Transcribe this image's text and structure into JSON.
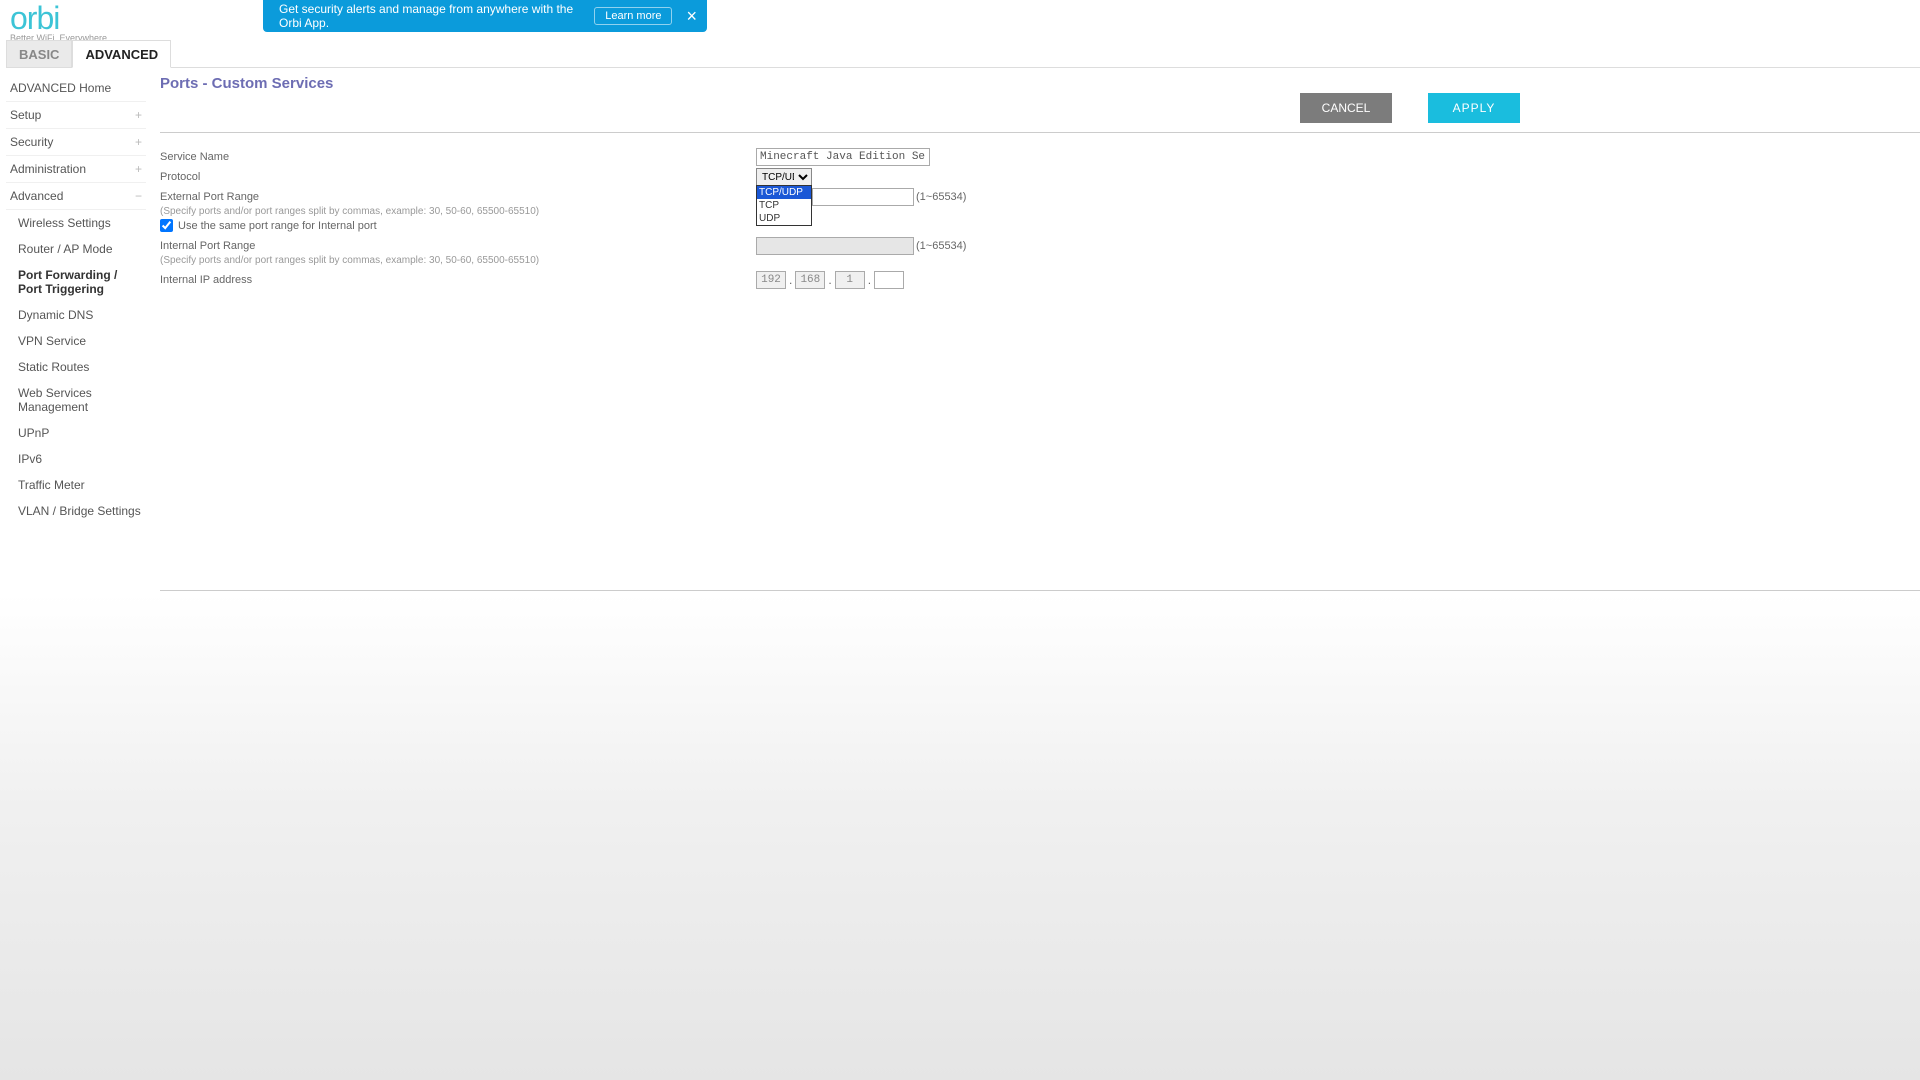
{
  "logo": {
    "brand": "orbi",
    "tagline": "Better WiFi. Everywhere."
  },
  "banner": {
    "text": "Get security alerts and manage from anywhere with the Orbi App.",
    "cta": "Learn more"
  },
  "tabs": {
    "basic": "BASIC",
    "advanced": "ADVANCED"
  },
  "sidebar": {
    "advanced_home": "ADVANCED Home",
    "setup": "Setup",
    "security": "Security",
    "administration": "Administration",
    "advanced": "Advanced",
    "sub": {
      "wireless": "Wireless Settings",
      "router_ap": "Router / AP Mode",
      "port_fw": "Port Forwarding / Port Triggering",
      "ddns": "Dynamic DNS",
      "vpn": "VPN Service",
      "static_routes": "Static Routes",
      "wsm": "Web Services Management",
      "upnp": "UPnP",
      "ipv6": "IPv6",
      "traffic": "Traffic Meter",
      "vlan": "VLAN / Bridge Settings"
    }
  },
  "page": {
    "title": "Ports - Custom Services",
    "cancel": "CANCEL",
    "apply": "APPLY"
  },
  "form": {
    "service_name_label": "Service Name",
    "service_name_value": "Minecraft Java Edition Serve",
    "protocol_label": "Protocol",
    "protocol_selected": "TCP/UDP",
    "protocol_options": [
      "TCP/UDP",
      "TCP",
      "UDP"
    ],
    "ext_range_label": "External Port Range",
    "hint": "(Specify ports and/or port ranges split by commas, example: 30, 50-60, 65500-65510)",
    "same_port_label": "Use the same port range for Internal port",
    "int_range_label": "Internal Port Range",
    "range_note": "(1~65534)",
    "int_ip_label": "Internal IP address",
    "ip": {
      "o1": "192",
      "o2": "168",
      "o3": "1",
      "o4": ""
    }
  }
}
